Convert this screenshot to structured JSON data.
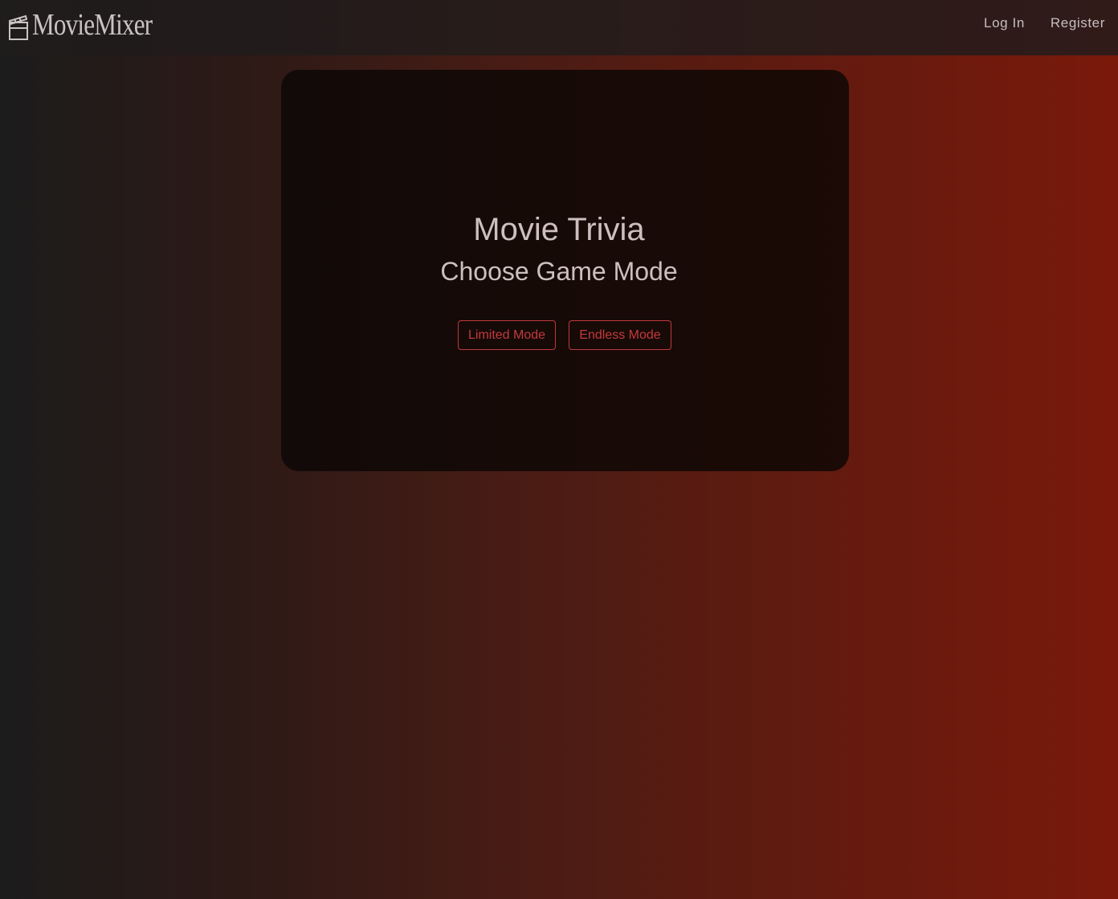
{
  "header": {
    "brand_name": "MovieMixer",
    "brand_icon": "clapperboard-icon",
    "nav": {
      "login_label": "Log In",
      "register_label": "Register"
    }
  },
  "main": {
    "title": "Movie Trivia",
    "subtitle": "Choose Game Mode",
    "buttons": {
      "limited_label": "Limited Mode",
      "endless_label": "Endless Mode"
    }
  },
  "colors": {
    "accent": "#c0383e",
    "text": "#cdbfbf",
    "background_start": "#1c1c1c",
    "background_end": "#7a190b",
    "card": "#160a07"
  }
}
